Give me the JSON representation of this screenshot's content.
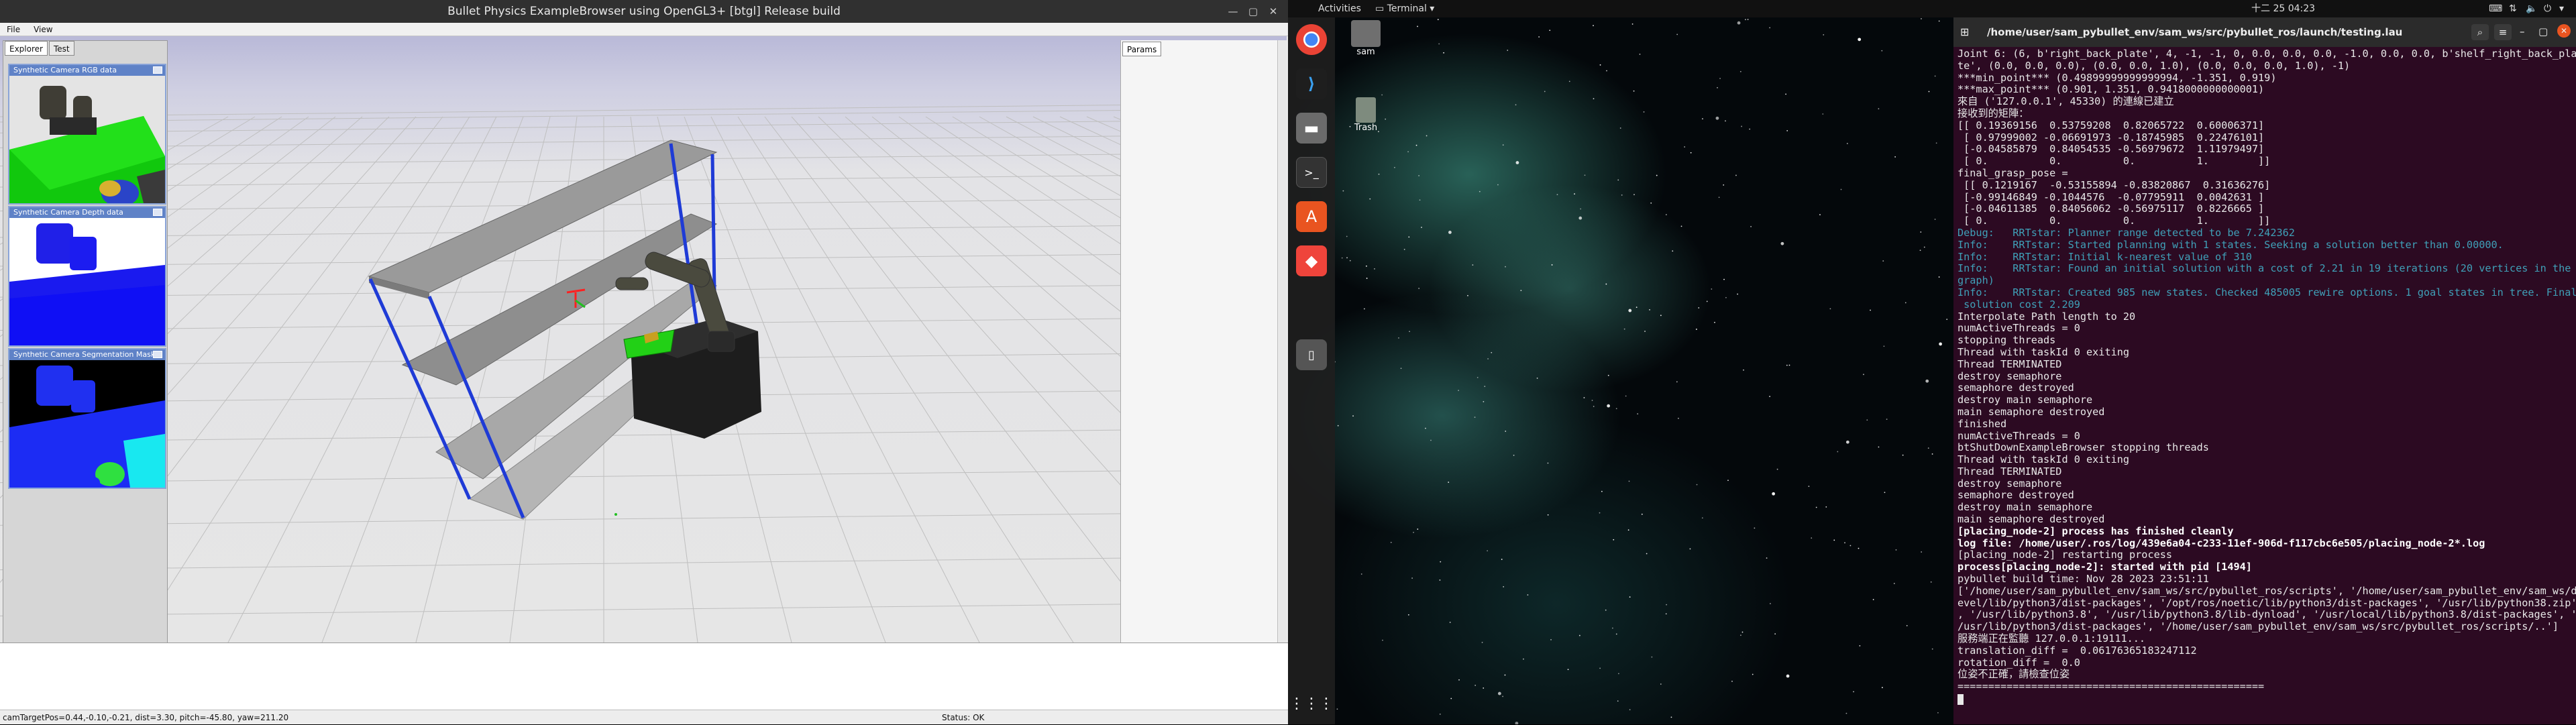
{
  "bullet": {
    "title": "Bullet Physics ExampleBrowser using OpenGL3+ [btgl] Release build",
    "menu": [
      "File",
      "View"
    ],
    "explorer_tabs": [
      "Explorer",
      "Test"
    ],
    "panels": [
      {
        "title": "Synthetic Camera RGB data"
      },
      {
        "title": "Synthetic Camera Depth data"
      },
      {
        "title": "Synthetic Camera Segmentation Mask"
      }
    ],
    "params_tab": "Params",
    "status_left": "camTargetPos=0.44,-0.10,-0.21, dist=3.30, pitch=-45.80, yaw=211.20",
    "status_right": "Status: OK"
  },
  "desktop": {
    "activities": "Activities",
    "app_menu": "Terminal",
    "clock": "十二 25  04:23",
    "dock": [
      {
        "name": "chrome-icon"
      },
      {
        "name": "vscode-icon"
      },
      {
        "name": "files-icon"
      },
      {
        "name": "terminal-icon"
      },
      {
        "name": "software-icon"
      },
      {
        "name": "anydesk-icon"
      },
      {
        "name": "usb-drive-icon"
      },
      {
        "name": "app-grid-icon"
      }
    ],
    "icons": [
      {
        "label": "sam"
      },
      {
        "label": "Trash"
      }
    ]
  },
  "terminal": {
    "title": "/home/user/sam_pybullet_env/sam_ws/src/pybullet_ros/launch/testing.launch http://l...",
    "lines": [
      {
        "t": "Joint 6: (6, b'right_back_plate', 4, -1, -1, 0, 0.0, 0.0, 0.0, -1.0, 0.0, 0.0, b'shelf_right_back_pla",
        "c": ""
      },
      {
        "t": "te', (0.0, 0.0, 0.0), (0.0, 0.0, 1.0), (0.0, 0.0, 0.0, 1.0), -1)",
        "c": ""
      },
      {
        "t": "***min_point*** (0.49899999999999994, -1.351, 0.919)",
        "c": ""
      },
      {
        "t": "***max_point*** (0.901, 1.351, 0.9418000000000001)",
        "c": ""
      },
      {
        "t": "來自 ('127.0.0.1', 45330) 的連線已建立",
        "c": ""
      },
      {
        "t": "接收到的矩陣：",
        "c": ""
      },
      {
        "t": "[[ 0.19369156  0.53759208  0.82065722  0.60006371]",
        "c": ""
      },
      {
        "t": " [ 0.97999002 -0.06691973 -0.18745985  0.22476101]",
        "c": ""
      },
      {
        "t": " [-0.04585879  0.84054535 -0.56979672  1.11979497]",
        "c": ""
      },
      {
        "t": " [ 0.          0.          0.          1.        ]]",
        "c": ""
      },
      {
        "t": "final_grasp_pose =",
        "c": ""
      },
      {
        "t": " [[ 0.1219167  -0.53155894 -0.83820867  0.31636276]",
        "c": ""
      },
      {
        "t": " [-0.99146849 -0.1044576  -0.07795911  0.0042631 ]",
        "c": ""
      },
      {
        "t": " [-0.04611385  0.84056062 -0.56975117  0.8226665 ]",
        "c": ""
      },
      {
        "t": " [ 0.          0.          0.          1.        ]]",
        "c": ""
      },
      {
        "t": "Debug:   RRTstar: Planner range detected to be 7.242362",
        "c": "info"
      },
      {
        "t": "Info:    RRTstar: Started planning with 1 states. Seeking a solution better than 0.00000.",
        "c": "info"
      },
      {
        "t": "Info:    RRTstar: Initial k-nearest value of 310",
        "c": "info"
      },
      {
        "t": "Info:    RRTstar: Found an initial solution with a cost of 2.21 in 19 iterations (20 vertices in the",
        "c": "info"
      },
      {
        "t": "graph)",
        "c": "info"
      },
      {
        "t": "Info:    RRTstar: Created 985 new states. Checked 485005 rewire options. 1 goal states in tree. Final",
        "c": "info"
      },
      {
        "t": " solution cost 2.209",
        "c": "info"
      },
      {
        "t": "Interpolate Path length to 20",
        "c": ""
      },
      {
        "t": "numActiveThreads = 0",
        "c": ""
      },
      {
        "t": "stopping threads",
        "c": ""
      },
      {
        "t": "Thread with taskId 0 exiting",
        "c": ""
      },
      {
        "t": "Thread TERMINATED",
        "c": ""
      },
      {
        "t": "destroy semaphore",
        "c": ""
      },
      {
        "t": "semaphore destroyed",
        "c": ""
      },
      {
        "t": "destroy main semaphore",
        "c": ""
      },
      {
        "t": "main semaphore destroyed",
        "c": ""
      },
      {
        "t": "finished",
        "c": ""
      },
      {
        "t": "numActiveThreads = 0",
        "c": ""
      },
      {
        "t": "btShutDownExampleBrowser stopping threads",
        "c": ""
      },
      {
        "t": "Thread with taskId 0 exiting",
        "c": ""
      },
      {
        "t": "Thread TERMINATED",
        "c": ""
      },
      {
        "t": "destroy semaphore",
        "c": ""
      },
      {
        "t": "semaphore destroyed",
        "c": ""
      },
      {
        "t": "destroy main semaphore",
        "c": ""
      },
      {
        "t": "main semaphore destroyed",
        "c": ""
      },
      {
        "t": "[placing_node-2] process has finished cleanly",
        "c": "bold"
      },
      {
        "t": "log file: /home/user/.ros/log/439e6a04-c233-11ef-906d-f117cbc6e505/placing_node-2*.log",
        "c": "bold"
      },
      {
        "t": "[placing_node-2] restarting process",
        "c": ""
      },
      {
        "t": "process[placing_node-2]: started with pid [1494]",
        "c": "bold"
      },
      {
        "t": "pybullet build time: Nov 28 2023 23:51:11",
        "c": ""
      },
      {
        "t": "['/home/user/sam_pybullet_env/sam_ws/src/pybullet_ros/scripts', '/home/user/sam_pybullet_env/sam_ws/d",
        "c": ""
      },
      {
        "t": "evel/lib/python3/dist-packages', '/opt/ros/noetic/lib/python3/dist-packages', '/usr/lib/python38.zip'",
        "c": ""
      },
      {
        "t": ", '/usr/lib/python3.8', '/usr/lib/python3.8/lib-dynload', '/usr/local/lib/python3.8/dist-packages', '",
        "c": ""
      },
      {
        "t": "/usr/lib/python3/dist-packages', '/home/user/sam_pybullet_env/sam_ws/src/pybullet_ros/scripts/..']",
        "c": ""
      },
      {
        "t": "服務端正在監聽 127.0.0.1:19111...",
        "c": ""
      },
      {
        "t": "translation_diff =  0.06176365183247112",
        "c": ""
      },
      {
        "t": "rotation_diff =  0.0",
        "c": ""
      },
      {
        "t": "位姿不正確，請檢查位姿",
        "c": ""
      },
      {
        "t": "==================================================",
        "c": ""
      }
    ]
  }
}
